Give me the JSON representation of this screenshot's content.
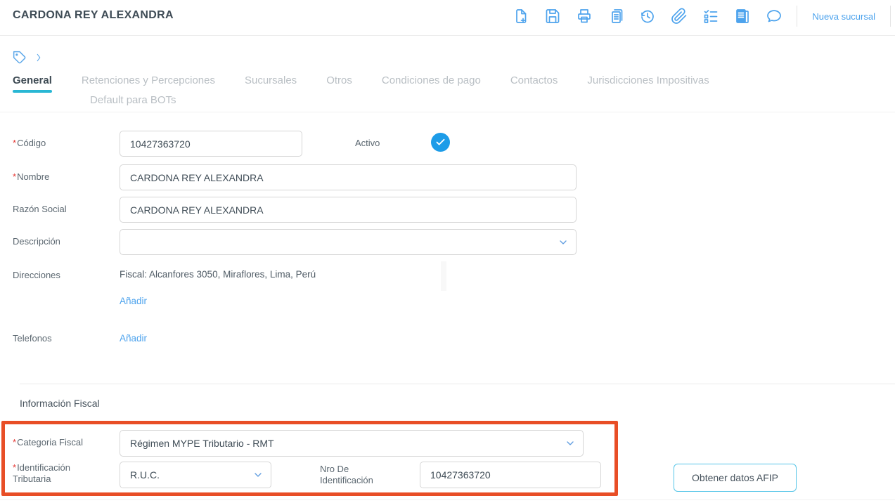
{
  "colors": {
    "accent_blue": "#4da3ed",
    "active_tab_underline": "#29b7d4",
    "highlight_box": "#e84e26",
    "check_blue": "#1d9ce8",
    "required_asterisk": "#e53935"
  },
  "header": {
    "title": "CARDONA REY ALEXANDRA",
    "new_branch_label": "Nueva sucursal",
    "toolbar_icons": [
      "new-document",
      "save",
      "print",
      "duplicate",
      "history",
      "attachment",
      "checklist",
      "journal",
      "comment"
    ]
  },
  "breadcrumb": {
    "icons": [
      "tag",
      "chevron-right"
    ]
  },
  "tabs": {
    "items": [
      {
        "label": "General",
        "active": true
      },
      {
        "label": "Retenciones y Percepciones",
        "active": false
      },
      {
        "label": "Sucursales",
        "active": false
      },
      {
        "label": "Otros",
        "active": false
      },
      {
        "label": "Condiciones de pago",
        "active": false
      },
      {
        "label": "Contactos",
        "active": false
      },
      {
        "label": "Jurisdicciones Impositivas",
        "active": false
      },
      {
        "label": "Default para BOTs",
        "active": false
      }
    ]
  },
  "form": {
    "codigo": {
      "label": "Código",
      "required": true,
      "value": "10427363720"
    },
    "activo": {
      "label": "Activo",
      "checked": true
    },
    "nombre": {
      "label": "Nombre",
      "required": true,
      "value": "CARDONA REY ALEXANDRA"
    },
    "razon_social": {
      "label": "Razón Social",
      "value": "CARDONA REY ALEXANDRA"
    },
    "descripcion": {
      "label": "Descripción",
      "value": ""
    },
    "direcciones": {
      "label": "Direcciones",
      "value": "Fiscal: Alcanfores 3050, Miraflores, Lima, Perú",
      "add_label": "Añadir"
    },
    "telefonos": {
      "label": "Telefonos",
      "add_label": "Añadir"
    }
  },
  "fiscal": {
    "section_title": "Información Fiscal",
    "categoria_fiscal": {
      "label": "Categoria Fiscal",
      "required": true,
      "value": "Régimen MYPE Tributario - RMT"
    },
    "identificacion_tributaria": {
      "label_line1": "Identificación",
      "label_line2": "Tributaria",
      "required": true,
      "value": "R.U.C."
    },
    "nro_identificacion": {
      "label_line1": "Nro De",
      "label_line2": "Identificación",
      "value": "10427363720"
    },
    "afip_button_label": "Obtener datos AFIP"
  }
}
